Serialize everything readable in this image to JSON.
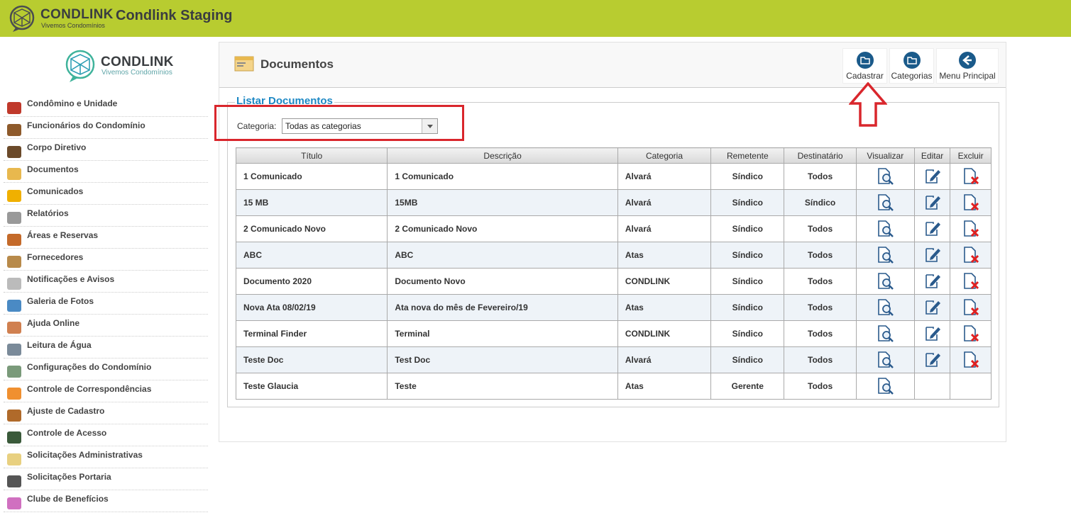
{
  "topbar": {
    "brand": "CONDLINK",
    "tagline": "Vivemos Condomínios",
    "app_title": "Condlink Staging"
  },
  "sidebar": {
    "brand": "CONDLINK",
    "tagline": "Vivemos Condomínios",
    "items": [
      {
        "label": "Condômino e Unidade",
        "icon": "people-icon"
      },
      {
        "label": "Funcionários do Condomínio",
        "icon": "employees-icon"
      },
      {
        "label": "Corpo Diretivo",
        "icon": "director-icon"
      },
      {
        "label": "Documentos",
        "icon": "documents-icon"
      },
      {
        "label": "Comunicados",
        "icon": "alert-icon"
      },
      {
        "label": "Relatórios",
        "icon": "report-icon"
      },
      {
        "label": "Áreas e Reservas",
        "icon": "calendar-icon"
      },
      {
        "label": "Fornecedores",
        "icon": "handshake-icon"
      },
      {
        "label": "Notificações e Avisos",
        "icon": "notification-icon"
      },
      {
        "label": "Galeria de Fotos",
        "icon": "gallery-icon"
      },
      {
        "label": "Ajuda Online",
        "icon": "help-icon"
      },
      {
        "label": "Leitura de Água",
        "icon": "water-tap-icon"
      },
      {
        "label": "Configurações do Condomínio",
        "icon": "settings-icon"
      },
      {
        "label": "Controle de Correspondências",
        "icon": "mail-icon"
      },
      {
        "label": "Ajuste de Cadastro",
        "icon": "briefcase-icon"
      },
      {
        "label": "Controle de Acesso",
        "icon": "access-icon"
      },
      {
        "label": "Solicitações Administrativas",
        "icon": "note-icon"
      },
      {
        "label": "Solicitações Portaria",
        "icon": "gate-icon"
      },
      {
        "label": "Clube de Benefícios",
        "icon": "benefits-icon"
      }
    ]
  },
  "page": {
    "title": "Documentos"
  },
  "toolbar": {
    "cadastrar": "Cadastrar",
    "categorias": "Categorias",
    "menu_principal": "Menu Principal"
  },
  "list": {
    "legend": "Listar Documentos",
    "category_label": "Categoria:",
    "category_value": "Todas as categorias"
  },
  "table": {
    "headers": [
      "Título",
      "Descrição",
      "Categoria",
      "Remetente",
      "Destinatário",
      "Visualizar",
      "Editar",
      "Excluir"
    ],
    "rows": [
      {
        "titulo": "1 Comunicado",
        "descricao": "1 Comunicado",
        "categoria": "Alvará",
        "remetente": "Síndico",
        "destinatario": "Todos",
        "editable": true
      },
      {
        "titulo": "15 MB",
        "descricao": "15MB",
        "categoria": "Alvará",
        "remetente": "Síndico",
        "destinatario": "Síndico",
        "editable": true
      },
      {
        "titulo": "2 Comunicado Novo",
        "descricao": "2 Comunicado Novo",
        "categoria": "Alvará",
        "remetente": "Síndico",
        "destinatario": "Todos",
        "editable": true
      },
      {
        "titulo": "ABC",
        "descricao": "ABC",
        "categoria": "Atas",
        "remetente": "Síndico",
        "destinatario": "Todos",
        "editable": true
      },
      {
        "titulo": "Documento 2020",
        "descricao": "Documento Novo",
        "categoria": "CONDLINK",
        "remetente": "Síndico",
        "destinatario": "Todos",
        "editable": true
      },
      {
        "titulo": "Nova Ata 08/02/19",
        "descricao": "Ata nova do mês de Fevereiro/19",
        "categoria": "Atas",
        "remetente": "Síndico",
        "destinatario": "Todos",
        "editable": true
      },
      {
        "titulo": "Terminal Finder",
        "descricao": "Terminal",
        "categoria": "CONDLINK",
        "remetente": "Síndico",
        "destinatario": "Todos",
        "editable": true
      },
      {
        "titulo": "Teste Doc",
        "descricao": "Test Doc",
        "categoria": "Alvará",
        "remetente": "Síndico",
        "destinatario": "Todos",
        "editable": true
      },
      {
        "titulo": "Teste Glaucia",
        "descricao": "Teste",
        "categoria": "Atas",
        "remetente": "Gerente",
        "destinatario": "Todos",
        "editable": false
      }
    ]
  },
  "colors": {
    "topbar": "#b8cc30",
    "accent": "#1d88c4",
    "highlight": "#d9262c",
    "icon_blue": "#2a5a8c"
  }
}
